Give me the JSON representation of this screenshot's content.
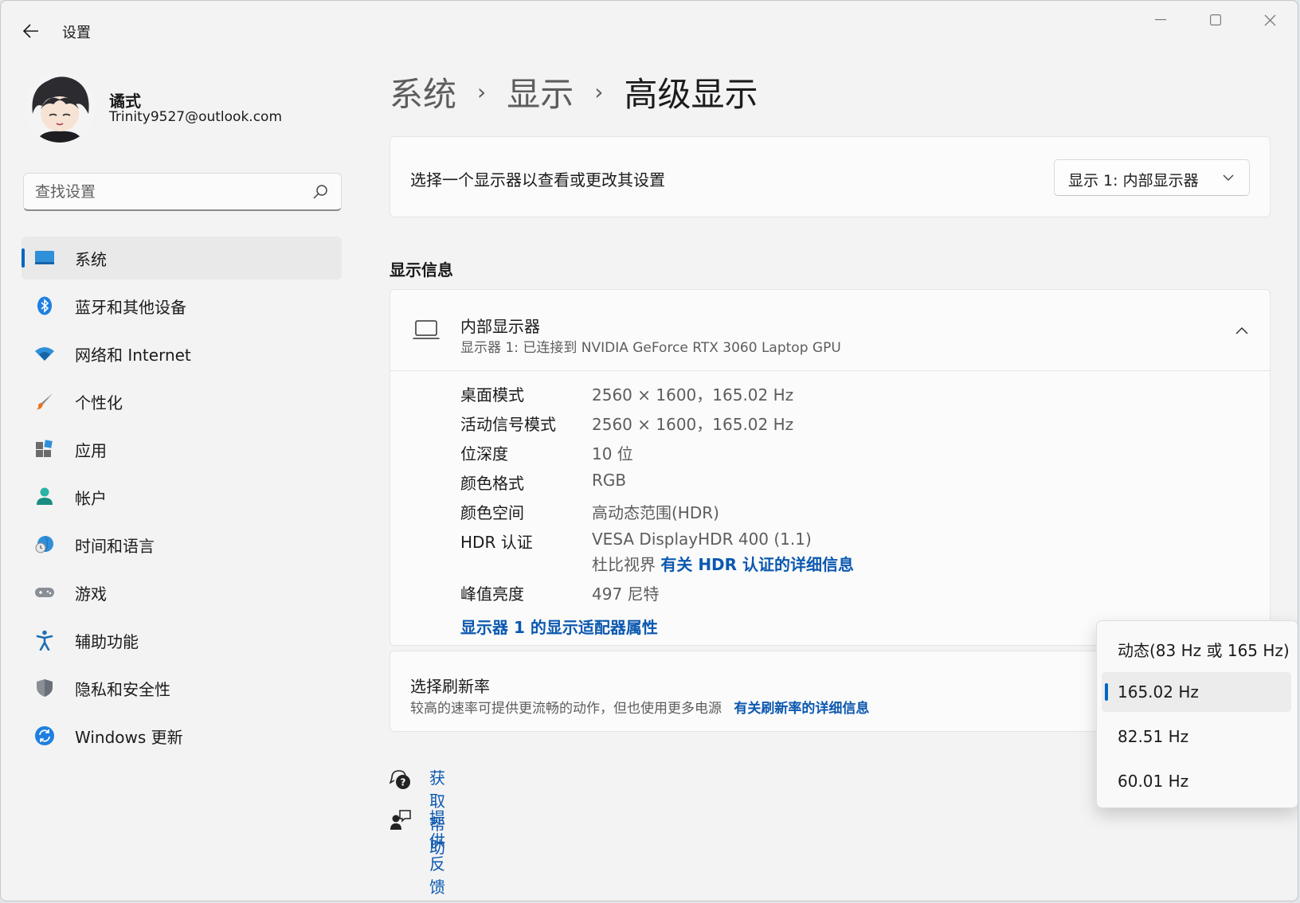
{
  "window": {
    "app_title": "设置",
    "controls": [
      "minimize-icon",
      "maximize-icon",
      "close-icon"
    ]
  },
  "profile": {
    "name": "谲式",
    "email": "Trinity9527@outlook.com"
  },
  "search": {
    "placeholder": "查找设置"
  },
  "sidebar": {
    "items": [
      {
        "label": "系统",
        "icon": "system-icon",
        "active": true
      },
      {
        "label": "蓝牙和其他设备",
        "icon": "bluetooth-icon"
      },
      {
        "label": "网络和 Internet",
        "icon": "wifi-icon"
      },
      {
        "label": "个性化",
        "icon": "brush-icon"
      },
      {
        "label": "应用",
        "icon": "apps-icon"
      },
      {
        "label": "帐户",
        "icon": "account-icon"
      },
      {
        "label": "时间和语言",
        "icon": "time-language-icon"
      },
      {
        "label": "游戏",
        "icon": "gaming-icon"
      },
      {
        "label": "辅助功能",
        "icon": "accessibility-icon"
      },
      {
        "label": "隐私和安全性",
        "icon": "shield-icon"
      },
      {
        "label": "Windows 更新",
        "icon": "update-icon"
      }
    ]
  },
  "breadcrumb": {
    "items": [
      "系统",
      "显示",
      "高级显示"
    ],
    "separator": "›"
  },
  "display_select": {
    "label": "选择一个显示器以查看或更改其设置",
    "value": "显示 1: 内部显示器"
  },
  "display_info": {
    "section_title": "显示信息",
    "title": "内部显示器",
    "subtitle": "显示器 1: 已连接到 NVIDIA GeForce RTX 3060 Laptop GPU",
    "rows": [
      {
        "key": "桌面模式",
        "value": "2560 × 1600，165.02 Hz"
      },
      {
        "key": "活动信号模式",
        "value": "2560 × 1600，165.02 Hz"
      },
      {
        "key": "位深度",
        "value": "10 位"
      },
      {
        "key": "颜色格式",
        "value": "RGB"
      },
      {
        "key": "颜色空间",
        "value": "高动态范围(HDR)"
      }
    ],
    "hdr": {
      "key": "HDR 认证",
      "value": "VESA DisplayHDR 400 (1.1)",
      "value2": "杜比视界",
      "link": "有关 HDR 认证的详细信息"
    },
    "peak": {
      "key": "峰值亮度",
      "value": "497 尼特"
    },
    "adapter_link": "显示器 1 的显示适配器属性"
  },
  "refresh": {
    "title": "选择刷新率",
    "description": "较高的速率可提供更流畅的动作，但也使用更多电源",
    "link": "有关刷新率的详细信息",
    "options": [
      "动态(83 Hz 或 165 Hz)",
      "165.02 Hz",
      "82.51 Hz",
      "60.01 Hz"
    ],
    "selected": "165.02 Hz"
  },
  "help": {
    "get_help": "获取帮助",
    "feedback": "提供反馈"
  },
  "colors": {
    "accent": "#0067c0",
    "link": "#0b58b0",
    "background": "#f3f3f3",
    "card": "#fbfbfb"
  }
}
